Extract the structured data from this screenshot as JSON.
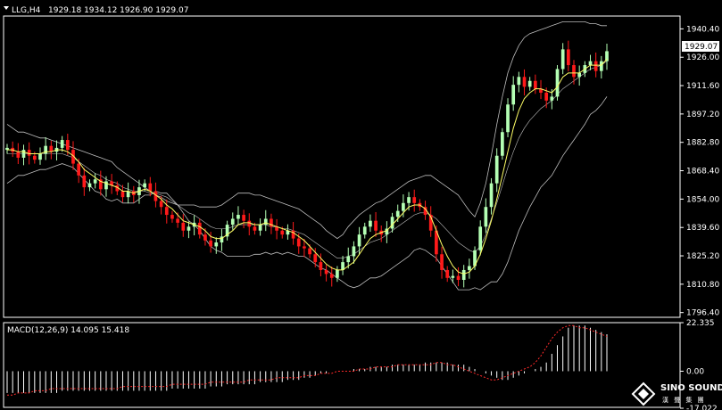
{
  "header": {
    "symbol": "LLG,H4",
    "ohlc": "1929.18 1934.12 1926.90 1929.07"
  },
  "macd_header": "MACD(12,26,9) 14.095 15.418",
  "current_price_label": "1929.07",
  "logo": {
    "name": "SINO SOUND",
    "sub": "漢 聲 集 團"
  },
  "colors": {
    "background": "#000000",
    "bull": "#b4ffb4",
    "bear": "#ff1a1a",
    "ma": "#ffff66",
    "band": "#bdbdbd",
    "macd_hist": "#ffffff",
    "macd_signal": "#ff2a2a",
    "grid_line": "#ffffff"
  },
  "chart_data": [
    {
      "type": "candlestick",
      "title": "LLG,H4",
      "y_ticks": [
        "1940.40",
        "1926.00",
        "1911.60",
        "1897.20",
        "1882.80",
        "1868.40",
        "1854.00",
        "1839.60",
        "1825.20",
        "1810.80",
        "1796.40"
      ],
      "ylim": [
        1794.0,
        1946.0
      ],
      "closes": [
        1880,
        1878,
        1875,
        1879,
        1876,
        1874,
        1877,
        1881,
        1878,
        1880,
        1884,
        1879,
        1872,
        1866,
        1860,
        1862,
        1864,
        1859,
        1863,
        1861,
        1858,
        1855,
        1858,
        1856,
        1860,
        1862,
        1858,
        1853,
        1850,
        1846,
        1844,
        1842,
        1838,
        1840,
        1842,
        1836,
        1833,
        1830,
        1832,
        1835,
        1841,
        1844,
        1846,
        1843,
        1840,
        1838,
        1841,
        1844,
        1840,
        1838,
        1836,
        1838,
        1834,
        1830,
        1829,
        1826,
        1822,
        1818,
        1816,
        1814,
        1818,
        1822,
        1825,
        1830,
        1836,
        1840,
        1843,
        1838,
        1836,
        1839,
        1845,
        1848,
        1852,
        1855,
        1852,
        1850,
        1846,
        1838,
        1826,
        1818,
        1814,
        1815,
        1813,
        1818,
        1820,
        1828,
        1840,
        1850,
        1862,
        1876,
        1888,
        1902,
        1912,
        1916,
        1911,
        1914,
        1910,
        1908,
        1904,
        1906,
        1920,
        1930,
        1922,
        1916,
        1918,
        1922,
        1924,
        1919,
        1924,
        1929.07
      ],
      "bollinger_upper": [
        1892,
        1890,
        1888,
        1888,
        1887,
        1886,
        1885,
        1885,
        1884,
        1883,
        1882,
        1881,
        1880,
        1879,
        1878,
        1877,
        1876,
        1875,
        1874,
        1873,
        1870,
        1868,
        1866,
        1864,
        1862,
        1860,
        1858,
        1856,
        1855,
        1853,
        1852,
        1851,
        1851,
        1851,
        1851,
        1850,
        1850,
        1850,
        1850,
        1851,
        1853,
        1855,
        1857,
        1857,
        1857,
        1856,
        1856,
        1855,
        1854,
        1853,
        1852,
        1851,
        1850,
        1849,
        1847,
        1845,
        1843,
        1841,
        1838,
        1836,
        1834,
        1836,
        1840,
        1843,
        1846,
        1848,
        1850,
        1852,
        1853,
        1855,
        1857,
        1859,
        1861,
        1863,
        1864,
        1865,
        1866,
        1866,
        1864,
        1862,
        1860,
        1858,
        1856,
        1852,
        1848,
        1845,
        1852,
        1862,
        1876,
        1892,
        1906,
        1918,
        1926,
        1932,
        1936,
        1938,
        1939,
        1940,
        1941,
        1942,
        1943,
        1944,
        1944,
        1944,
        1944,
        1944,
        1943,
        1943,
        1942,
        1942
      ],
      "bollinger_middle": [
        1877,
        1877,
        1877,
        1877,
        1877,
        1877,
        1877,
        1877,
        1877,
        1877,
        1877,
        1876,
        1875,
        1873,
        1871,
        1869,
        1867,
        1866,
        1864,
        1863,
        1862,
        1860,
        1859,
        1858,
        1858,
        1858,
        1857,
        1857,
        1856,
        1855,
        1853,
        1851,
        1849,
        1847,
        1846,
        1844,
        1842,
        1840,
        1839,
        1839,
        1839,
        1840,
        1841,
        1841,
        1841,
        1841,
        1841,
        1841,
        1840,
        1840,
        1839,
        1839,
        1838,
        1837,
        1836,
        1834,
        1832,
        1830,
        1828,
        1826,
        1824,
        1824,
        1825,
        1826,
        1828,
        1830,
        1832,
        1833,
        1834,
        1836,
        1838,
        1840,
        1842,
        1844,
        1846,
        1847,
        1847,
        1846,
        1844,
        1841,
        1838,
        1835,
        1832,
        1830,
        1828,
        1827,
        1830,
        1836,
        1844,
        1852,
        1861,
        1870,
        1878,
        1885,
        1890,
        1894,
        1897,
        1900,
        1902,
        1904,
        1907,
        1910,
        1912,
        1914,
        1916,
        1918,
        1920,
        1921,
        1922,
        1924
      ],
      "bollinger_lower": [
        1862,
        1864,
        1866,
        1866,
        1867,
        1868,
        1869,
        1869,
        1870,
        1871,
        1872,
        1871,
        1870,
        1867,
        1864,
        1861,
        1858,
        1857,
        1854,
        1853,
        1854,
        1852,
        1852,
        1852,
        1854,
        1856,
        1856,
        1858,
        1857,
        1857,
        1854,
        1851,
        1847,
        1843,
        1841,
        1838,
        1834,
        1830,
        1828,
        1827,
        1825,
        1825,
        1825,
        1825,
        1825,
        1826,
        1826,
        1827,
        1826,
        1827,
        1826,
        1827,
        1826,
        1825,
        1825,
        1823,
        1821,
        1819,
        1818,
        1816,
        1814,
        1812,
        1810,
        1809,
        1810,
        1812,
        1814,
        1814,
        1815,
        1817,
        1819,
        1821,
        1823,
        1825,
        1828,
        1829,
        1828,
        1826,
        1824,
        1820,
        1816,
        1812,
        1808,
        1808,
        1808,
        1809,
        1808,
        1810,
        1812,
        1812,
        1816,
        1822,
        1830,
        1838,
        1844,
        1850,
        1855,
        1860,
        1863,
        1866,
        1871,
        1876,
        1880,
        1884,
        1888,
        1892,
        1897,
        1899,
        1902,
        1906
      ],
      "ma_line": [
        1879,
        1879,
        1878,
        1878,
        1877,
        1877,
        1877,
        1878,
        1878,
        1879,
        1879,
        1878,
        1876,
        1873,
        1869,
        1867,
        1865,
        1863,
        1862,
        1861,
        1860,
        1858,
        1858,
        1857,
        1858,
        1859,
        1858,
        1856,
        1854,
        1851,
        1849,
        1846,
        1843,
        1842,
        1841,
        1840,
        1838,
        1835,
        1834,
        1834,
        1836,
        1838,
        1841,
        1842,
        1842,
        1841,
        1841,
        1842,
        1841,
        1840,
        1839,
        1838,
        1837,
        1835,
        1833,
        1830,
        1827,
        1824,
        1821,
        1819,
        1818,
        1818,
        1820,
        1822,
        1826,
        1830,
        1834,
        1836,
        1837,
        1838,
        1841,
        1844,
        1847,
        1850,
        1851,
        1851,
        1849,
        1845,
        1838,
        1831,
        1825,
        1820,
        1817,
        1816,
        1817,
        1820,
        1826,
        1834,
        1843,
        1854,
        1866,
        1878,
        1890,
        1899,
        1905,
        1908,
        1910,
        1910,
        1909,
        1908,
        1911,
        1916,
        1918,
        1918,
        1918,
        1920,
        1922,
        1922,
        1922,
        1925
      ]
    },
    {
      "type": "bar",
      "title": "MACD(12,26,9) 14.095 15.418",
      "y_ticks": [
        "22.335",
        "0.00",
        "-17.022"
      ],
      "ylim": [
        -17.022,
        22.335
      ],
      "histogram": [
        -10,
        -10,
        -10,
        -10,
        -10,
        -10,
        -10,
        -10,
        -10,
        -10,
        -9,
        -9,
        -9,
        -9,
        -9,
        -9,
        -9,
        -9,
        -9,
        -9,
        -9,
        -9,
        -9,
        -9,
        -9,
        -9,
        -9,
        -9,
        -9,
        -9,
        -8,
        -8,
        -8,
        -8,
        -8,
        -8,
        -8,
        -7,
        -7,
        -7,
        -6,
        -6,
        -6,
        -6,
        -6,
        -6,
        -5,
        -5,
        -5,
        -5,
        -5,
        -4,
        -4,
        -4,
        -3,
        -3,
        -2,
        -1,
        -1,
        0,
        0,
        0,
        0,
        1,
        1,
        1,
        2,
        2,
        2,
        2,
        3,
        3,
        3,
        3,
        3,
        3,
        4,
        4,
        4,
        4,
        4,
        3,
        3,
        3,
        2,
        1,
        0,
        -1,
        -2,
        -3,
        -4,
        -4,
        -3,
        -2,
        -1,
        0,
        1,
        2,
        4,
        8,
        12,
        16,
        20,
        21,
        21,
        21,
        20,
        19,
        18,
        17
      ],
      "signal": [
        -11,
        -11,
        -10,
        -10,
        -10,
        -9,
        -9,
        -9,
        -8,
        -8,
        -8,
        -8,
        -8,
        -8,
        -8,
        -8,
        -8,
        -8,
        -8,
        -8,
        -8,
        -7,
        -7,
        -7,
        -7,
        -7,
        -7,
        -7,
        -7,
        -7,
        -6,
        -6,
        -6,
        -6,
        -6,
        -6,
        -6,
        -5,
        -5,
        -5,
        -5,
        -5,
        -5,
        -5,
        -4,
        -4,
        -4,
        -4,
        -4,
        -3,
        -3,
        -3,
        -3,
        -3,
        -2,
        -2,
        -2,
        -1,
        -1,
        -1,
        0,
        0,
        0,
        0,
        1,
        1,
        1,
        2,
        2,
        2,
        2,
        3,
        3,
        3,
        3,
        3,
        3,
        3,
        4,
        4,
        3,
        3,
        2,
        1,
        0,
        -1,
        -2,
        -3,
        -4,
        -4,
        -3,
        -2,
        -1,
        0,
        1,
        2,
        4,
        7,
        11,
        15,
        18,
        20,
        21,
        21,
        20,
        20,
        19,
        18,
        17,
        16
      ]
    }
  ]
}
